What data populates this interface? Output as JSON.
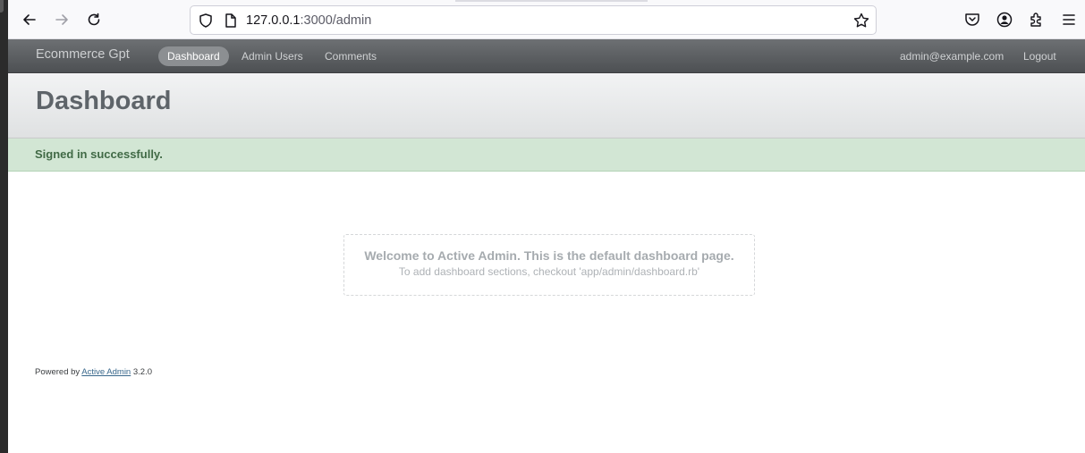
{
  "browser": {
    "url_host": "127.0.0.1",
    "url_path": ":3000/admin"
  },
  "header": {
    "brand": "Ecommerce Gpt",
    "tabs": [
      {
        "label": "Dashboard",
        "active": true
      },
      {
        "label": "Admin Users",
        "active": false
      },
      {
        "label": "Comments",
        "active": false
      }
    ],
    "user_email": "admin@example.com",
    "logout_label": "Logout"
  },
  "title": "Dashboard",
  "flash": "Signed in successfully.",
  "blank_slate": {
    "heading": "Welcome to Active Admin. This is the default dashboard page.",
    "subtext": "To add dashboard sections, checkout 'app/admin/dashboard.rb'"
  },
  "footer": {
    "prefix": "Powered by",
    "link": "Active Admin",
    "version": "3.2.0"
  },
  "colors": {
    "header_bg": "#5e6164",
    "flash_bg": "#d2e6d4",
    "flash_text": "#416a46",
    "title_text": "#5e6469"
  },
  "icons": [
    "back-icon",
    "forward-icon",
    "reload-icon",
    "shield-icon",
    "page-icon",
    "bookmark-star-icon",
    "pocket-icon",
    "account-icon",
    "extensions-icon",
    "menu-icon"
  ]
}
